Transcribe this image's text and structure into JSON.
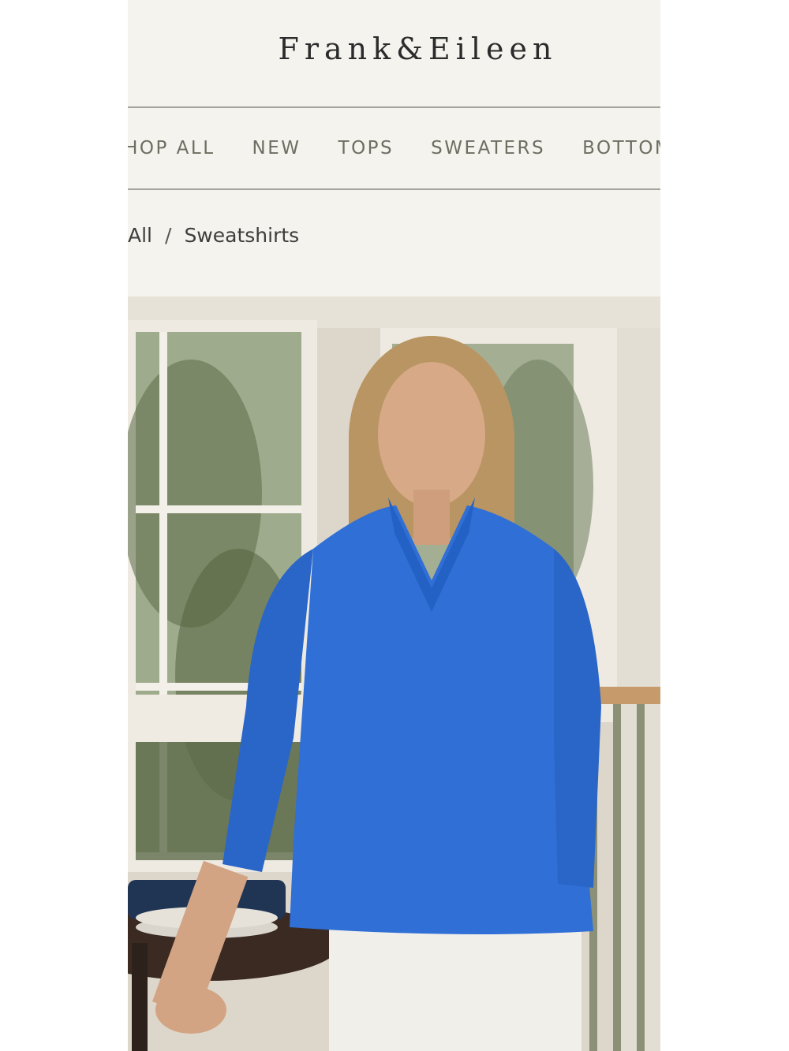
{
  "brand": {
    "logo_text": "Frank&Eileen"
  },
  "nav": {
    "items": [
      {
        "label": "SHOP ALL"
      },
      {
        "label": "NEW"
      },
      {
        "label": "TOPS"
      },
      {
        "label": "SWEATERS"
      },
      {
        "label": "BOTTOMS"
      }
    ]
  },
  "breadcrumb": {
    "parent": "All",
    "separator": "/",
    "current": "Sweatshirts"
  },
  "hero": {
    "alt": "Model wearing a blue ruffle-collar sweatshirt",
    "sweatshirt_color": "#2f6fd6"
  }
}
